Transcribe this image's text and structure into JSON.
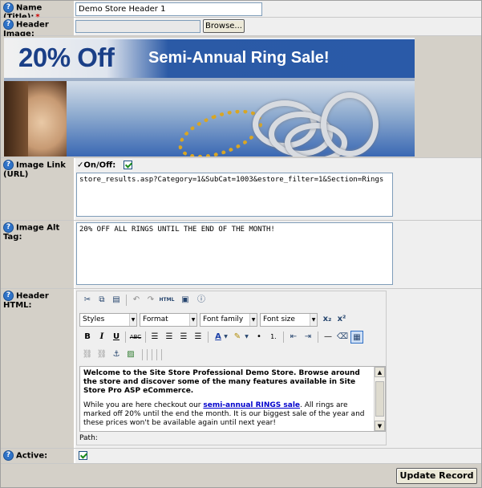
{
  "fields": {
    "name_label": "Name (Title):",
    "name_required_mark": "*",
    "name_value": "Demo Store Header 1",
    "header_image_label": "Header Image:",
    "browse_label": "Browse...",
    "image_link_label": "Image Link (URL)",
    "onoff_label": "On/Off:",
    "onoff_checked": true,
    "image_link_value": "store_results.asp?Category=1&SubCat=1003&estore_filter=1&Section=Rings",
    "alt_tag_label": "Image Alt Tag:",
    "alt_tag_value": "20% OFF ALL RINGS UNTIL THE END OF THE MONTH!",
    "header_html_label": "Header HTML:",
    "active_label": "Active:",
    "active_checked": true
  },
  "banner": {
    "big_text": "20% Off",
    "small_text": "Semi-Annual Ring Sale!"
  },
  "editor": {
    "toolbar_row1": [
      "cut-icon",
      "copy-icon",
      "paste-word-icon",
      "undo-icon",
      "redo-icon",
      "html-source-icon",
      "fullscreen-icon",
      "help-icon"
    ],
    "html_icon_text": "HTML",
    "styles": "Styles",
    "format": "Format",
    "font_family": "Font family",
    "font_size": "Font size",
    "sub_label": "x₂",
    "sup_label": "x²",
    "bold": "B",
    "italic": "I",
    "underline": "U",
    "strike": "ABC",
    "text_color": "A",
    "content_p1": "Welcome to the Site Store Professional Demo Store. Browse around the store and discover some of the many features available in Site Store Pro ASP eCommerce.",
    "content_p2_before": "While you are here checkout our ",
    "content_link": "semi-annual RINGS sale",
    "content_p2_after": ". All rings are marked off 20% until the end the month. It is our biggest sale of the year and these prices won't be available again until next year!",
    "path_label": "Path:"
  },
  "footer": {
    "update_label": "Update Record"
  }
}
